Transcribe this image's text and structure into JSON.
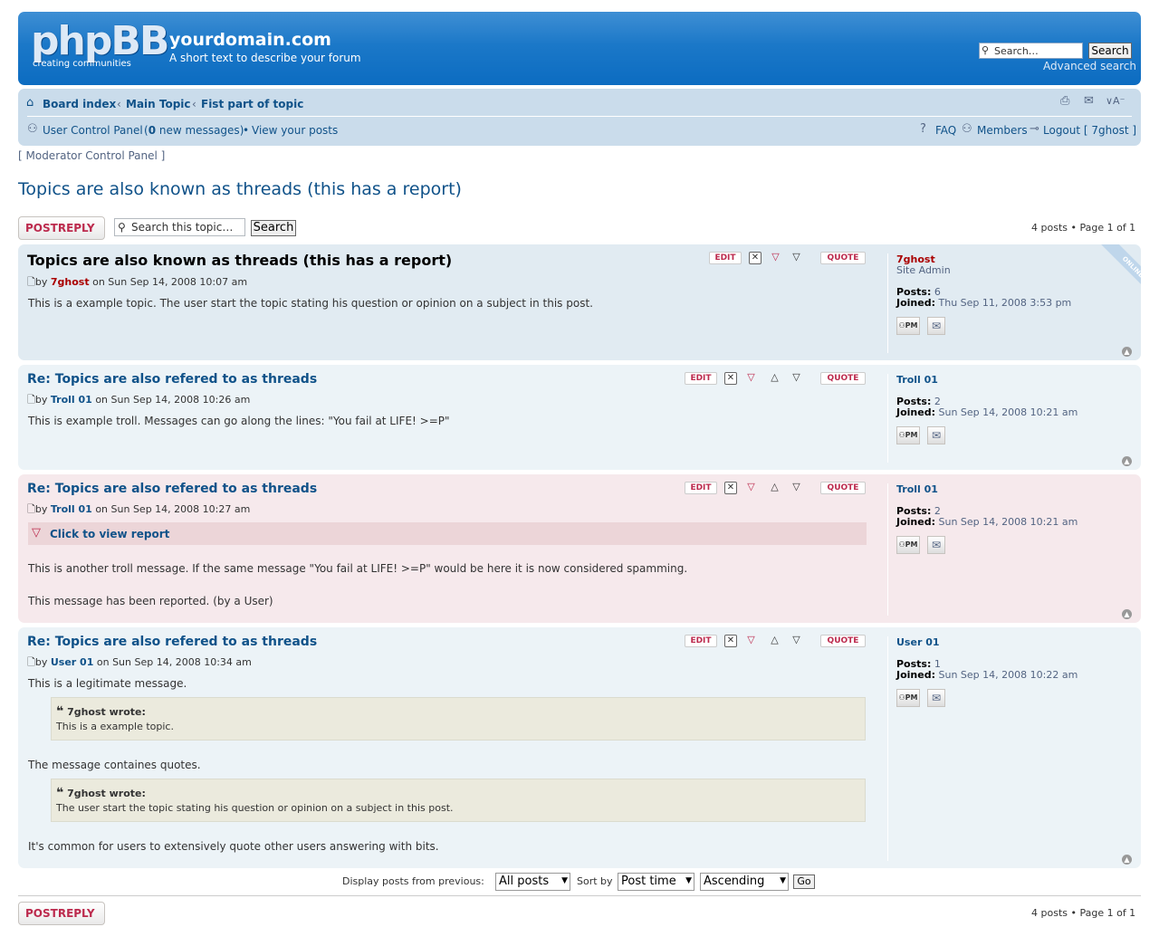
{
  "header": {
    "logo_text": "phpBB",
    "logo_tagline": "creating communities",
    "site_title": "yourdomain.com",
    "site_description": "A short text to describe your forum",
    "search_placeholder": "Search…",
    "search_button": "Search",
    "advanced_search": "Advanced search"
  },
  "navbar": {
    "breadcrumbs": [
      "Board index",
      "Main Topic",
      "Fist part of topic"
    ],
    "breadcrumb_separator": "‹",
    "ucp_label": "User Control Panel",
    "new_messages_count": "0",
    "new_messages_label": "new messages",
    "view_posts": "View your posts",
    "faq": "FAQ",
    "members": "Members",
    "logout": "Logout [ 7ghost ]"
  },
  "mcp_link": "[ Moderator Control Panel ]",
  "topic": {
    "title": "Topics are also known as threads (this has a report)",
    "postreply_label": "POSTREPLY",
    "search_placeholder": "Search this topic…",
    "search_button": "Search",
    "pagination": "4 posts • Page 1 of 1"
  },
  "post_buttons": {
    "edit": "EDIT",
    "quote": "QUOTE"
  },
  "online_label": "ONLINE",
  "report_link": "Click to view report",
  "posts": [
    {
      "title": "Topics are also known as threads (this has a report)",
      "by": "by",
      "author": "7ghost",
      "date": "on Sun Sep 14, 2008 10:07 am",
      "content": "This is a example topic. The user start the topic stating his question or opinion on a subject in this post.",
      "profile_name": "7ghost",
      "profile_rank": "Site Admin",
      "posts_label": "Posts:",
      "posts_count": "6",
      "joined_label": "Joined:",
      "joined": "Thu Sep 11, 2008 3:53 pm"
    },
    {
      "title": "Re: Topics are also refered to as threads",
      "by": "by",
      "author": "Troll 01",
      "date": "on Sun Sep 14, 2008 10:26 am",
      "content": "This is example troll. Messages can go along the lines: \"You fail at LIFE! >=P\"",
      "profile_name": "Troll 01",
      "posts_label": "Posts:",
      "posts_count": "2",
      "joined_label": "Joined:",
      "joined": "Sun Sep 14, 2008 10:21 am"
    },
    {
      "title": "Re: Topics are also refered to as threads",
      "by": "by",
      "author": "Troll 01",
      "date": "on Sun Sep 14, 2008 10:27 am",
      "content": "This is another troll message. If the same message \"You fail at LIFE! >=P\" would be here it is now considered spamming.",
      "content2": "This message has been reported. (by a User)",
      "profile_name": "Troll 01",
      "posts_label": "Posts:",
      "posts_count": "2",
      "joined_label": "Joined:",
      "joined": "Sun Sep 14, 2008 10:21 am"
    },
    {
      "title": "Re: Topics are also refered to as threads",
      "by": "by",
      "author": "User 01",
      "date": "on Sun Sep 14, 2008 10:34 am",
      "content": "This is a legitimate message.",
      "quote1_cite": "7ghost wrote:",
      "quote1_text": "This is a example topic.",
      "content_mid": "The message containes quotes.",
      "quote2_cite": "7ghost wrote:",
      "quote2_text": "The user start the topic stating his question or opinion on a subject in this post.",
      "content_end": "It's common for users to extensively quote other users answering with bits.",
      "profile_name": "User 01",
      "posts_label": "Posts:",
      "posts_count": "1",
      "joined_label": "Joined:",
      "joined": "Sun Sep 14, 2008 10:22 am"
    }
  ],
  "display_controls": {
    "display_label": "Display posts from previous:",
    "display_value": "All posts",
    "sort_label": "Sort by",
    "sort_value": "Post time",
    "order_value": "Ascending",
    "go_button": "Go"
  },
  "colors": {
    "link": "#105289",
    "postreply": "#bc2a4d",
    "header_blue": "#0c6cc1",
    "navbar_bg": "#cadceb",
    "post_bg1": "#ecf3f7",
    "post_bg2": "#e1ebf2",
    "reported_bg": "#f6e9ec",
    "admin_name": "#aa0000"
  },
  "icons": {
    "search": "search-icon",
    "home": "home-icon",
    "print": "print-icon",
    "email": "email-icon",
    "font_size": "font-size-icon",
    "faq": "faq-icon",
    "members": "members-icon",
    "logout": "logout-icon",
    "ucp": "ucp-icon"
  }
}
